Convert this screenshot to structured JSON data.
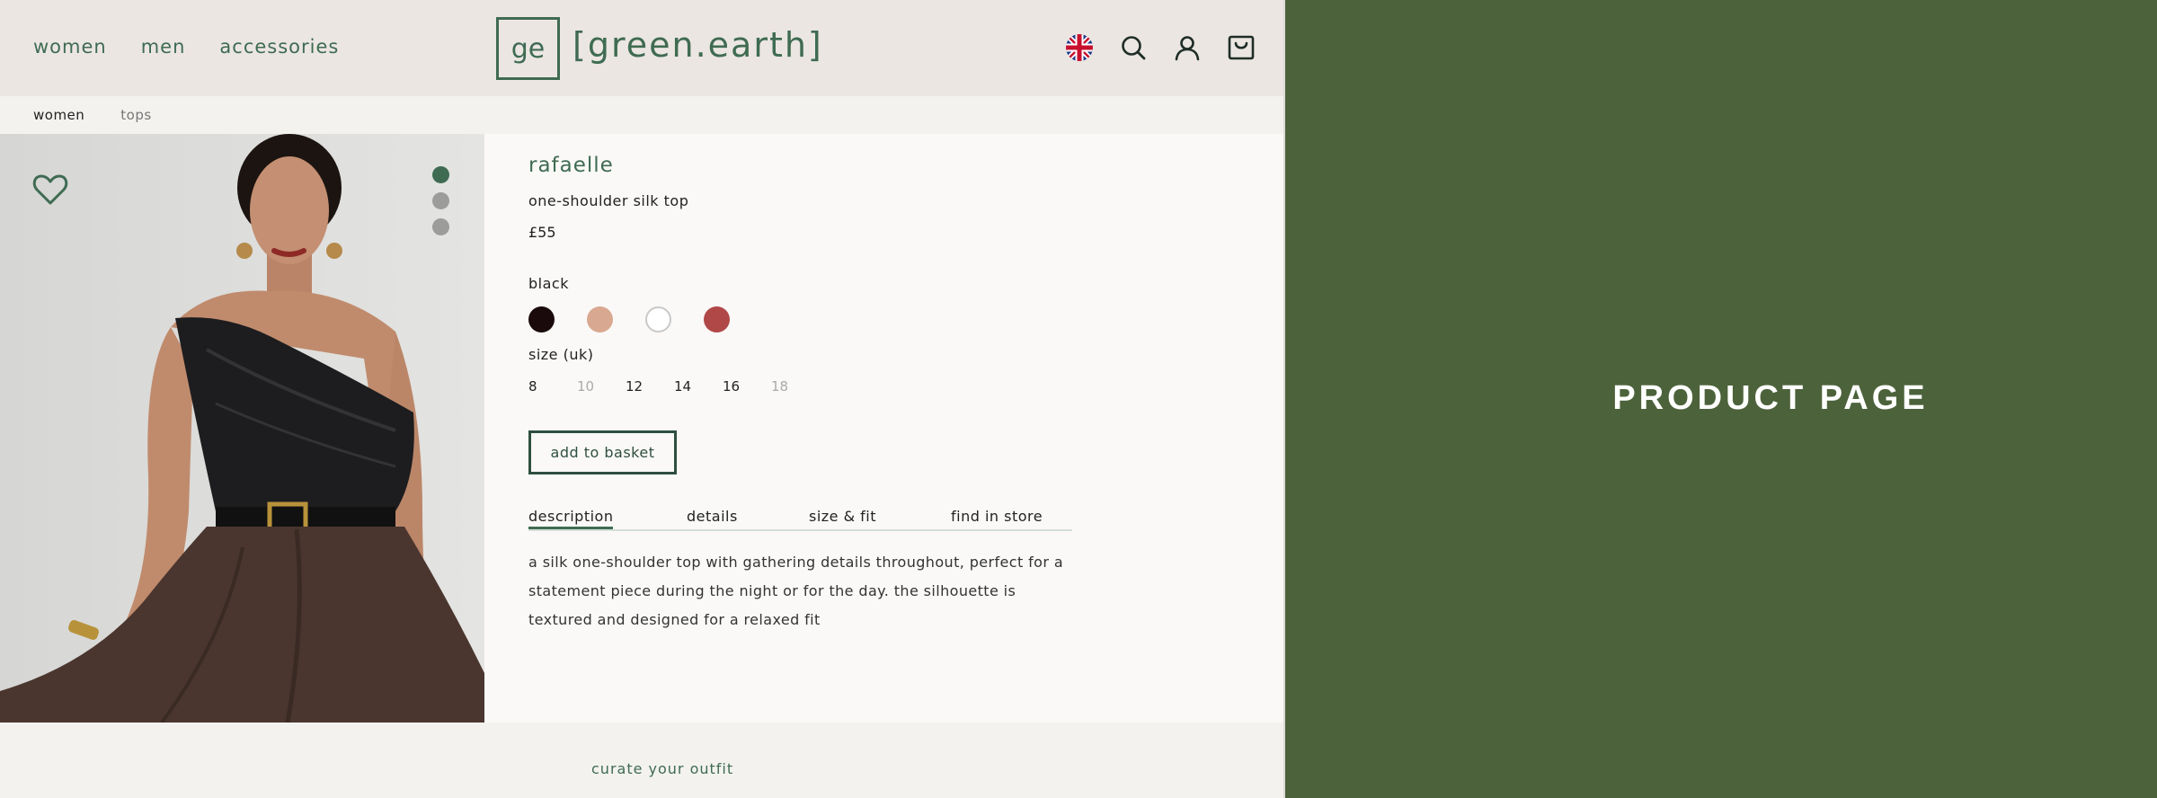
{
  "header": {
    "nav": [
      "women",
      "men",
      "accessories"
    ],
    "logo_mark": "ge",
    "logo_text": "[green.earth]",
    "icons": [
      "uk-flag-icon",
      "search-icon",
      "user-icon",
      "basket-icon"
    ]
  },
  "breadcrumb": [
    "women",
    "tops"
  ],
  "product": {
    "brand": "rafaelle",
    "name": "one-shoulder silk top",
    "price": "£55",
    "selected_color": "black",
    "swatches": [
      "#1a0a0b",
      "#d9a891",
      "#ffffff",
      "#b04848"
    ],
    "size_label": "size (uk)",
    "sizes": [
      {
        "label": "8",
        "available": true
      },
      {
        "label": "10",
        "available": false
      },
      {
        "label": "12",
        "available": true
      },
      {
        "label": "14",
        "available": true
      },
      {
        "label": "16",
        "available": true
      },
      {
        "label": "18",
        "available": false
      }
    ],
    "add_button": "add to basket",
    "tabs": [
      "description",
      "details",
      "size & fit",
      "find in store"
    ],
    "description": "a silk one-shoulder top with gathering details throughout, perfect for a statement piece during the night or for the day. the silhouette is textured and designed for a relaxed fit",
    "gallery_slide": 1,
    "gallery_total": 3
  },
  "footer": {
    "curate": "curate your outfit"
  },
  "banner": {
    "title": "PRODUCT PAGE"
  },
  "colors": {
    "brand_green": "#3f6b52",
    "banner_green": "#4c623b",
    "header_bg": "#ebe6e1"
  }
}
